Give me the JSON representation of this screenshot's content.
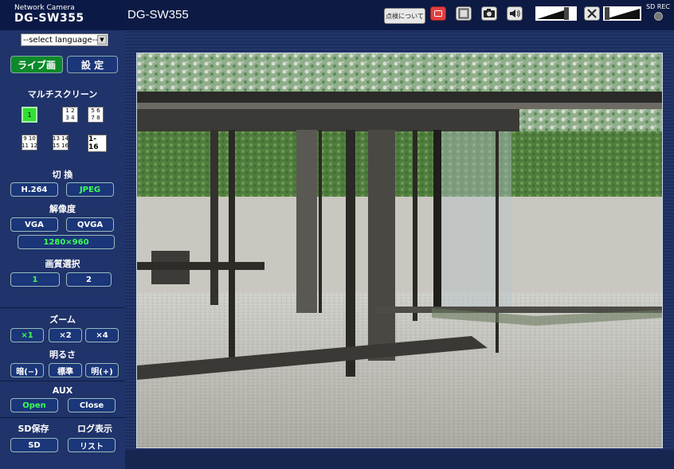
{
  "header": {
    "brand_sub": "Network Camera",
    "brand_model": "DG-SW355",
    "title": "DG-SW355",
    "status_button_label": "点検について",
    "sd_rec_label": "SD REC",
    "icons": [
      "alarm-icon",
      "fullscreen-icon",
      "snapshot-icon",
      "speaker-icon",
      "volume-bar-icon",
      "mic-mute-icon",
      "mic-volume-bar-icon"
    ]
  },
  "sidebar": {
    "language_select": "--select language--",
    "tabs": {
      "live": "ライブ画",
      "setup": "設 定"
    },
    "multiscreen": {
      "title": "マルチスクリーン",
      "buttons": [
        "1",
        "1 2\n3 4",
        "5 6\n7 8",
        "9 10\n11 12",
        "13 14\n15 16",
        "1-16"
      ]
    },
    "switch": {
      "title": "切 換",
      "h264": "H.264",
      "jpeg": "JPEG"
    },
    "resolution": {
      "title": "解像度",
      "vga": "VGA",
      "qvga": "QVGA",
      "hd": "1280×960"
    },
    "quality": {
      "title": "画質選択",
      "q1": "1",
      "q2": "2"
    },
    "zoom": {
      "title": "ズーム",
      "x1": "×1",
      "x2": "×2",
      "x4": "×4"
    },
    "brightness": {
      "title": "明るさ",
      "dark": "暗(−)",
      "normal": "標準",
      "bright": "明(+)"
    },
    "aux": {
      "title": "AUX",
      "open": "Open",
      "close": "Close"
    },
    "sd": {
      "title": "SD保存",
      "button": "SD"
    },
    "log": {
      "title": "ログ表示",
      "button": "リスト"
    }
  },
  "colors": {
    "active_green": "#3cff5a",
    "panel_bg": "#20336a",
    "header_bg": "#0b1946"
  }
}
